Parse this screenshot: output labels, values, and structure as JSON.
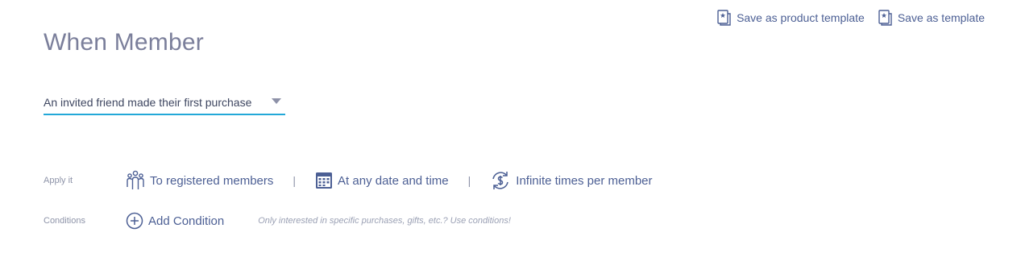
{
  "header": {
    "title": "When Member",
    "actions": [
      {
        "label": "Save as product template",
        "icon": "template-icon"
      },
      {
        "label": "Save as template",
        "icon": "template-icon"
      }
    ]
  },
  "trigger": {
    "value": "An invited friend made their first purchase"
  },
  "apply": {
    "label": "Apply it",
    "audience": "To registered members",
    "schedule": "At any date and time",
    "frequency": "Infinite times per member",
    "separator": "|"
  },
  "conditions": {
    "label": "Conditions",
    "add_label": "Add Condition",
    "hint": "Only interested in specific purchases, gifts, etc.? Use conditions!"
  },
  "colors": {
    "accent": "#23a8d8",
    "link": "#4c5f94",
    "title": "#7b7f9b"
  }
}
